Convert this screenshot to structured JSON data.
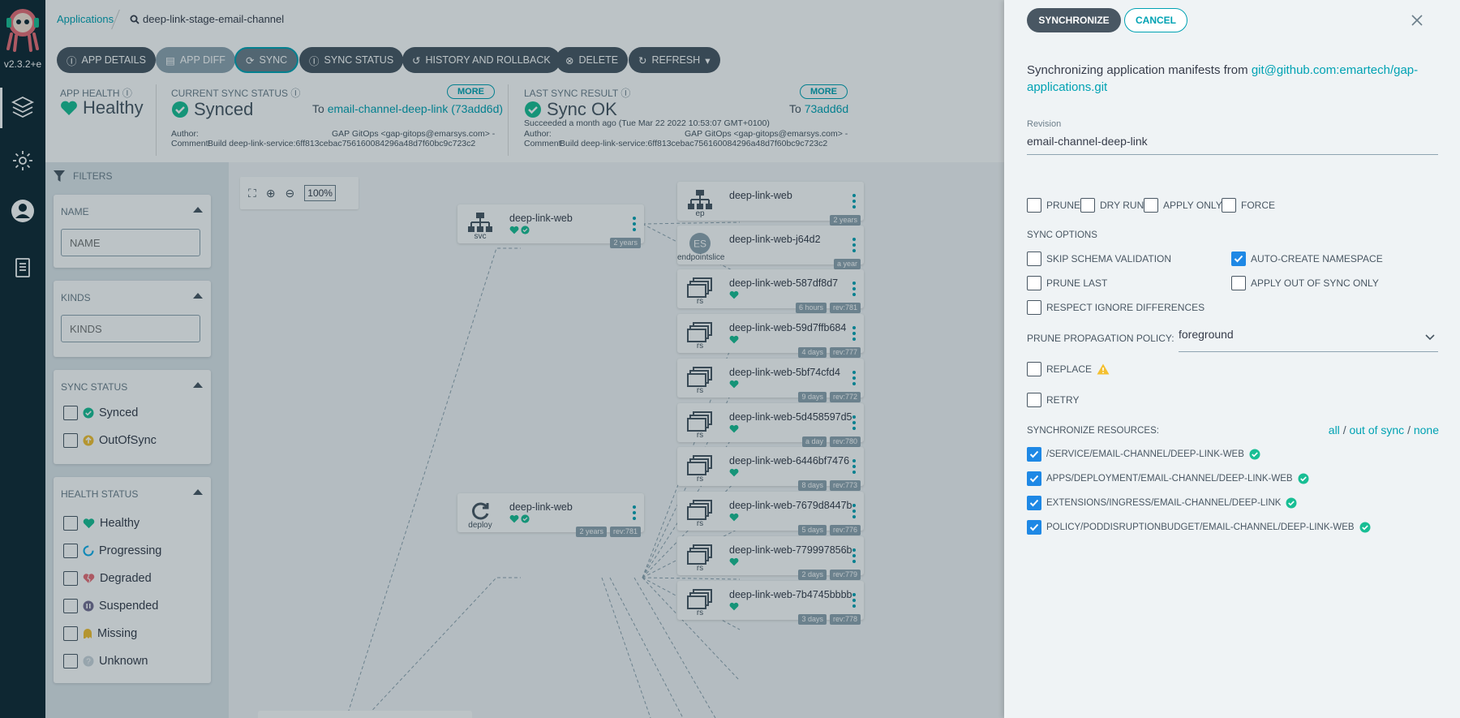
{
  "app": {
    "version": "v2.3.2+e",
    "breadcrumb_root": "Applications",
    "search_value": "deep-link-stage-email-channel"
  },
  "toolbar": {
    "app_details": "APP DETAILS",
    "app_diff": "APP DIFF",
    "sync": "SYNC",
    "sync_status": "SYNC STATUS",
    "history": "HISTORY AND ROLLBACK",
    "delete": "DELETE",
    "refresh": "REFRESH"
  },
  "status": {
    "health_label": "APP HEALTH",
    "health_value": "Healthy",
    "current_label": "CURRENT SYNC STATUS",
    "current_value": "Synced",
    "current_to_prefix": "To",
    "current_to_link": "email-channel-deep-link (73add6d)",
    "more": "MORE",
    "author_label": "Author:",
    "comment_label": "Comment:",
    "author_value": "GAP GitOps <gap-gitops@emarsys.com> -",
    "comment_value": "Build deep-link-service:6ff813cebac756160084296a48d7f60bc9c723c2",
    "last_label": "LAST SYNC RESULT",
    "last_value": "Sync OK",
    "last_to_prefix": "To",
    "last_to_link": "73add6d",
    "last_time": "Succeeded a month ago (Tue Mar 22 2022 10:53:07 GMT+0100)",
    "last_author_value": "GAP GitOps <gap-gitops@emarsys.com> -",
    "last_comment_value": "Build deep-link-service:6ff813cebac756160084296a48d7f60bc9c723c2"
  },
  "filters": {
    "title": "FILTERS",
    "name_title": "NAME",
    "name_placeholder": "NAME",
    "kinds_title": "KINDS",
    "kinds_placeholder": "KINDS",
    "sync_title": "SYNC STATUS",
    "sync_items": [
      "Synced",
      "OutOfSync"
    ],
    "health_title": "HEALTH STATUS",
    "health_items": [
      "Healthy",
      "Progressing",
      "Degraded",
      "Suspended",
      "Missing",
      "Unknown"
    ]
  },
  "graph": {
    "zoom": "100%",
    "nodes": [
      {
        "name": "deep-link-web",
        "kind": "svc",
        "age": "2 years",
        "rev": ""
      },
      {
        "name": "deep-link-web",
        "kind": "deploy",
        "age": "2 years",
        "rev": "rev:781"
      },
      {
        "name": "deep-link-web",
        "kind": "ep",
        "age": "2 years",
        "rev": ""
      },
      {
        "name": "deep-link-web-j64d2",
        "kind": "endpointslice",
        "age": "a year",
        "rev": ""
      },
      {
        "name": "deep-link-web-587df8d7",
        "kind": "rs",
        "age": "6 hours",
        "rev": "rev:781"
      },
      {
        "name": "deep-link-web-59d7ffb684",
        "kind": "rs",
        "age": "4 days",
        "rev": "rev:777"
      },
      {
        "name": "deep-link-web-5bf74cfd4",
        "kind": "rs",
        "age": "9 days",
        "rev": "rev:772"
      },
      {
        "name": "deep-link-web-5d458597d5",
        "kind": "rs",
        "age": "a day",
        "rev": "rev:780"
      },
      {
        "name": "deep-link-web-6446bf7476",
        "kind": "rs",
        "age": "8 days",
        "rev": "rev:773"
      },
      {
        "name": "deep-link-web-7679d8447b",
        "kind": "rs",
        "age": "5 days",
        "rev": "rev:776"
      },
      {
        "name": "deep-link-web-779997856b",
        "kind": "rs",
        "age": "2 days",
        "rev": "rev:779"
      },
      {
        "name": "deep-link-web-7b4745bbbb",
        "kind": "rs",
        "age": "3 days",
        "rev": "rev:778"
      }
    ],
    "es_label": "ES"
  },
  "panel": {
    "synchronize": "SYNCHRONIZE",
    "cancel": "CANCEL",
    "intro": "Synchronizing application manifests from",
    "repo": "git@github.com:emartech/gap-applications.git",
    "revision_label": "Revision",
    "revision_value": "email-channel-deep-link",
    "top_options": [
      "PRUNE",
      "DRY RUN",
      "APPLY ONLY",
      "FORCE"
    ],
    "sync_options_title": "SYNC OPTIONS",
    "opt_skip_schema": "SKIP SCHEMA VALIDATION",
    "opt_auto_create": "AUTO-CREATE NAMESPACE",
    "opt_prune_last": "PRUNE LAST",
    "opt_apply_out": "APPLY OUT OF SYNC ONLY",
    "opt_respect": "RESPECT IGNORE DIFFERENCES",
    "prune_policy_label": "PRUNE PROPAGATION POLICY:",
    "prune_policy_value": "foreground",
    "replace": "REPLACE",
    "retry": "RETRY",
    "resources_title": "SYNCHRONIZE RESOURCES:",
    "res_all": "all",
    "res_out": "out of sync",
    "res_none": "none",
    "res_sep": "/",
    "resources": [
      "/SERVICE/EMAIL-CHANNEL/DEEP-LINK-WEB",
      "APPS/DEPLOYMENT/EMAIL-CHANNEL/DEEP-LINK-WEB",
      "EXTENSIONS/INGRESS/EMAIL-CHANNEL/DEEP-LINK",
      "POLICY/PODDISRUPTIONBUDGET/EMAIL-CHANNEL/DEEP-LINK-WEB"
    ]
  },
  "colors": {
    "accent": "#00a2b3",
    "healthy": "#18be94",
    "nav_bg": "#0f2733",
    "button": "#495763",
    "checkbox_on": "#1e88e5",
    "warning": "#f4c030"
  }
}
